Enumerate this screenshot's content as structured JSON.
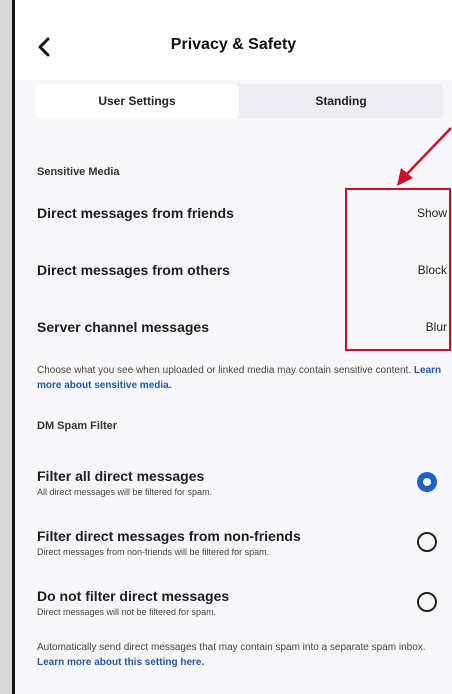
{
  "header": {
    "title": "Privacy & Safety"
  },
  "tabs": [
    {
      "label": "User Settings",
      "active": true
    },
    {
      "label": "Standing",
      "active": false
    }
  ],
  "sensitive_media": {
    "title": "Sensitive Media",
    "rows": [
      {
        "label": "Direct messages from friends",
        "value": "Show"
      },
      {
        "label": "Direct messages from others",
        "value": "Block"
      },
      {
        "label": "Server channel messages",
        "value": "Blur"
      }
    ],
    "help_text": "Choose what you see when uploaded or linked media may contain sensitive content.",
    "help_link": "Learn more about sensitive media."
  },
  "dm_spam_filter": {
    "title": "DM Spam Filter",
    "options": [
      {
        "title": "Filter all direct messages",
        "subtitle": "All direct messages will be filtered for spam.",
        "selected": true
      },
      {
        "title": "Filter direct messages from non-friends",
        "subtitle": "Direct messages from non-friends will be filtered for spam.",
        "selected": false
      },
      {
        "title": "Do not filter direct messages",
        "subtitle": "Direct messages will not be filtered for spam.",
        "selected": false
      }
    ],
    "help_text": "Automatically send direct messages that may contain spam into a separate spam inbox.",
    "help_link": "Learn more about this setting here."
  },
  "colors": {
    "accent": "#1b5fc9",
    "link": "#1f5aa8",
    "annotation": "#c8102e"
  }
}
